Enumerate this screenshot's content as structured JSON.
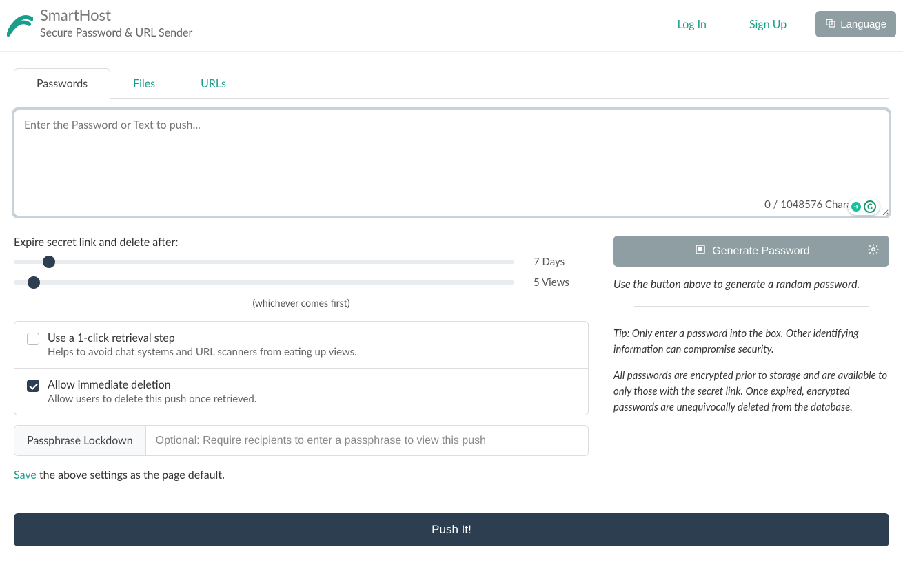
{
  "header": {
    "brand_title": "SmartHost",
    "brand_subtitle": "Secure Password & URL Sender",
    "login_label": "Log In",
    "signup_label": "Sign Up",
    "language_label": "Language"
  },
  "tabs": {
    "passwords": "Passwords",
    "files": "Files",
    "urls": "URLs"
  },
  "payload": {
    "placeholder": "Enter the Password or Text to push...",
    "value": "",
    "count_text": "0 / 1048576 Characters"
  },
  "expire": {
    "label": "Expire secret link and delete after:",
    "days_label": "7 Days",
    "views_label": "5 Views",
    "note": "(whichever comes first)"
  },
  "options": {
    "oneclick_title": "Use a 1-click retrieval step",
    "oneclick_sub": "Helps to avoid chat systems and URL scanners from eating up views.",
    "allowdel_title": "Allow immediate deletion",
    "allowdel_sub": "Allow users to delete this push once retrieved."
  },
  "passphrase": {
    "addon": "Passphrase Lockdown",
    "placeholder": "Optional: Require recipients to enter a passphrase to view this push"
  },
  "save_line": {
    "link": "Save",
    "rest": " the above settings as the page default."
  },
  "right": {
    "generate_label": "Generate Password",
    "generate_note": "Use the button above to generate a random password.",
    "tip": "Tip: Only enter a password into the box. Other identifying information can compromise security.",
    "encrypt_note": "All passwords are encrypted prior to storage and are available to only those with the secret link. Once expired, encrypted passwords are unequivocally deleted from the database."
  },
  "push_label": "Push It!"
}
